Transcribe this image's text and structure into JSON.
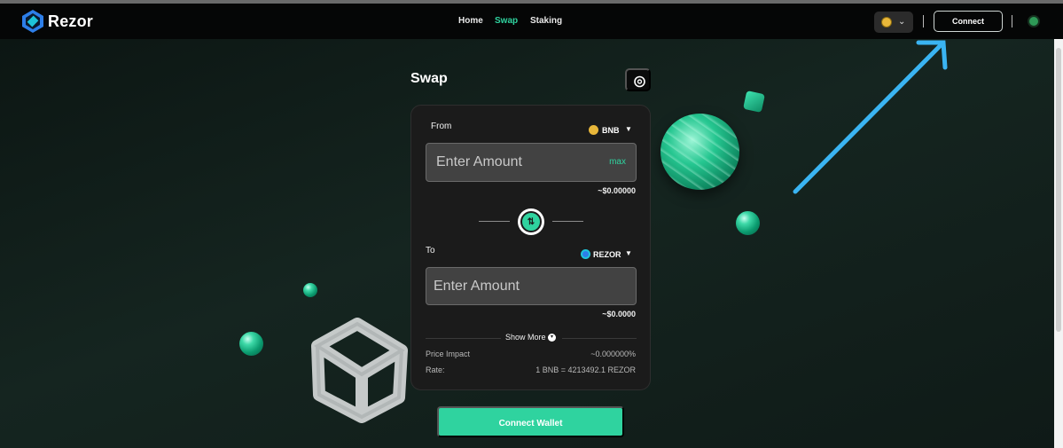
{
  "app": {
    "brand": "Rezor"
  },
  "nav": {
    "links": [
      {
        "label": "Home",
        "active": false
      },
      {
        "label": "Swap",
        "active": true
      },
      {
        "label": "Staking",
        "active": false
      }
    ],
    "connect_label": "Connect",
    "coin_icon": "bnb-coin-icon",
    "status_color": "#2e9a57"
  },
  "swap": {
    "title": "Swap",
    "from": {
      "label": "From",
      "token": "BNB",
      "placeholder": "Enter Amount",
      "max_label": "max",
      "usd_value": "~$0.00000"
    },
    "to": {
      "label": "To",
      "token": "REZOR",
      "placeholder": "Enter Amount",
      "usd_value": "~$0.0000"
    },
    "show_more_label": "Show More",
    "details": [
      {
        "label": "Price Impact",
        "value": "~0.000000%"
      },
      {
        "label": "Rate:",
        "value": "1 BNB = 4213492.1 REZOR"
      }
    ]
  },
  "connect_wallet_label": "Connect Wallet",
  "colors": {
    "accent": "#2fd39f",
    "background": "#141a18",
    "navbar": "#050606",
    "card": "#1b1b1b",
    "annotation_arrow": "#3ab4f2"
  }
}
